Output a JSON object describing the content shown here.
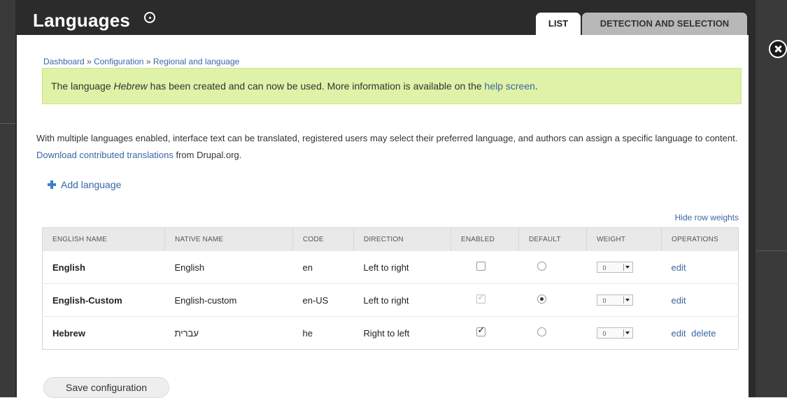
{
  "header": {
    "title": "Languages"
  },
  "tabs": [
    {
      "label": "LIST",
      "active": true
    },
    {
      "label": "DETECTION AND SELECTION",
      "active": false
    }
  ],
  "breadcrumb": [
    "Dashboard",
    "Configuration",
    "Regional and language"
  ],
  "breadcrumb_separator": "»",
  "status": {
    "prefix": "The language ",
    "language": "Hebrew",
    "middle": " has been created and can now be used. More information is available on the ",
    "link": "help screen",
    "suffix": "."
  },
  "intro": {
    "text": "With multiple languages enabled, interface text can be translated, registered users may select their preferred language, and authors can assign a specific language to content. ",
    "link": "Download contributed translations",
    "suffix": " from Drupal.org."
  },
  "actions": {
    "add_language": "Add language",
    "row_weights_toggle": "Hide row weights",
    "save_label": "Save configuration"
  },
  "table": {
    "headers": [
      "ENGLISH NAME",
      "NATIVE NAME",
      "CODE",
      "DIRECTION",
      "ENABLED",
      "DEFAULT",
      "WEIGHT",
      "OPERATIONS"
    ],
    "rows": [
      {
        "english": "English",
        "native": "English",
        "code": "en",
        "direction": "Left to right",
        "enabled": false,
        "enabled_disabled": false,
        "default": false,
        "weight": "0",
        "ops": [
          "edit"
        ]
      },
      {
        "english": "English-Custom",
        "native": "English-custom",
        "code": "en-US",
        "direction": "Left to right",
        "enabled": true,
        "enabled_disabled": true,
        "default": true,
        "weight": "0",
        "ops": [
          "edit"
        ]
      },
      {
        "english": "Hebrew",
        "native": "עברית",
        "code": "he",
        "direction": "Right to left",
        "enabled": true,
        "enabled_disabled": false,
        "default": false,
        "weight": "0",
        "ops": [
          "edit",
          "delete"
        ]
      }
    ]
  },
  "colors": {
    "link": "#3a66a5",
    "status_bg": "#dff2a7",
    "header_bg": "#2b2b2b"
  }
}
